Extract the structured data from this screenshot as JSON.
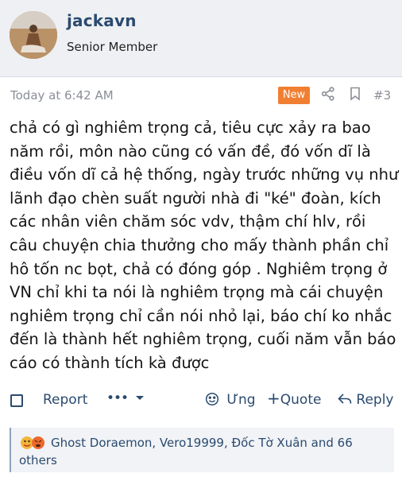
{
  "user": {
    "name": "jackavn",
    "title": "Senior Member"
  },
  "post": {
    "time": "Today at 6:42 AM",
    "badge": "New",
    "number": "#3",
    "lines": [
      "chả có gì nghiêm trọng cả, tiêu cực xảy ra bao",
      "năm rồi, môn nào cũng có vấn đề, đó vốn dĩ là",
      "điều vốn dĩ cả hệ thống, ngày trước những vụ như",
      "lãnh đạo chèn suất người nhà đi \"ké\" đoàn, kích",
      "các nhân viên chăm sóc vdv, thậm chí hlv, rồi",
      "câu chuyện chia thưởng cho mấy thành phần chỉ",
      "hô tốn nc bọt, chả có đóng góp . Nghiêm trọng ở",
      "VN chỉ khi ta nói là nghiêm trọng mà cái chuyện",
      "nghiêm trọng chỉ cần nói nhỏ lại, báo chí ko nhắc",
      "đến là thành hết nghiêm trọng, cuối năm vẫn báo",
      "cáo có thành tích kà được"
    ]
  },
  "actions": {
    "report": "Report",
    "more": "•••",
    "react": "Ưng",
    "quote": "Quote",
    "reply": "Reply"
  },
  "reactions": {
    "line1": "Ghost Doraemon, Vero19999, Đốc Tờ Xuân and 66",
    "line2": "others"
  },
  "colors": {
    "accent": "#2b4a6f",
    "badge": "#f07f32",
    "meta": "#8a8f96"
  }
}
